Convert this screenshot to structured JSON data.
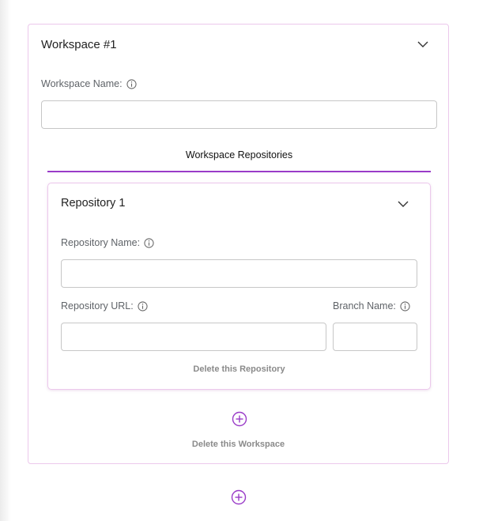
{
  "workspace": {
    "title": "Workspace #1",
    "name_label": "Workspace Name:",
    "name_value": "",
    "tab_label": "Workspace Repositories",
    "delete_label": "Delete this Workspace"
  },
  "repository": {
    "title": "Repository 1",
    "name_label": "Repository Name:",
    "name_value": "",
    "url_label": "Repository URL:",
    "url_value": "",
    "branch_label": "Branch Name:",
    "branch_value": "",
    "delete_label": "Delete this Repository"
  },
  "icons": {
    "collapse": "chevron-down-icon",
    "info": "info-icon",
    "add": "plus-circle-icon"
  },
  "colors": {
    "accent": "#9a3cc8",
    "card_border": "#ecc8ec",
    "muted_text": "#8a8a8a"
  }
}
